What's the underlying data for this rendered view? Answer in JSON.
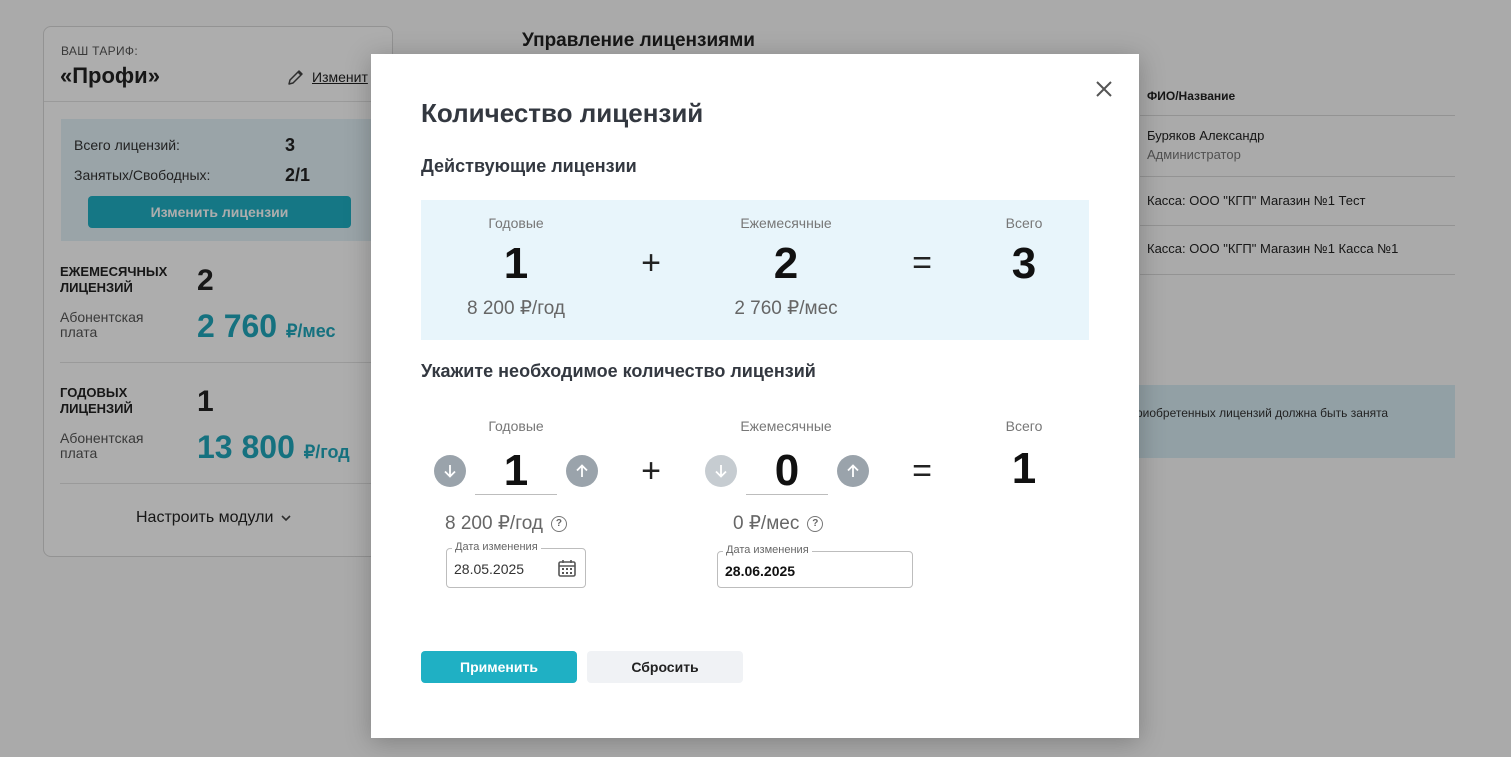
{
  "background": {
    "tariff": {
      "label": "ВАШ ТАРИФ:",
      "name": "«Профи»",
      "edit_label": "Изменит"
    },
    "licenses": {
      "total_label": "Всего лицензий:",
      "total_value": "3",
      "busy_label": "Занятых/Свободных:",
      "busy_value": "2/1",
      "change_button": "Изменить лицензии"
    },
    "monthly": {
      "title_line1": "ЕЖЕМЕСЯЧНЫХ",
      "title_line2": "лицензий",
      "count": "2",
      "fee_line1": "Абонентская",
      "fee_line2": "плата",
      "fee_value": "2 760",
      "fee_unit": "₽/мес"
    },
    "annual": {
      "title_line1": "ГОДОВЫХ",
      "title_line2": "лицензий",
      "count": "1",
      "fee_line1": "Абонентская",
      "fee_line2": "плата",
      "fee_value": "13 800",
      "fee_unit": "₽/год"
    },
    "modules_label": "Настроить модули",
    "management_title": "Управление лицензиями",
    "users_table": {
      "header": "ФИО/Название",
      "rows": [
        {
          "name": "Буряков Александр",
          "role": "Администратор"
        },
        {
          "name": "Касса: ООО \"КГП\" Магазин №1 Тест",
          "role": ""
        },
        {
          "name": "Касса: ООО \"КГП\" Магазин №1 Касса №1",
          "role": ""
        }
      ]
    },
    "info_text": "риобретенных лицензий должна быть занята"
  },
  "modal": {
    "title": "Количество лицензий",
    "current_title": "Действующие лицензии",
    "current": {
      "annual_caption": "Годовые",
      "annual_count": "1",
      "annual_price": "8 200 ₽/год",
      "plus": "+",
      "monthly_caption": "Ежемесячные",
      "monthly_count": "2",
      "monthly_price": "2 760 ₽/мес",
      "equals": "=",
      "total_caption": "Всего",
      "total_count": "3"
    },
    "needed_title": "Укажите необходимое количество лицензий",
    "needed": {
      "annual_caption": "Годовые",
      "annual_count": "1",
      "annual_price": "8 200 ₽/год",
      "monthly_caption": "Ежемесячные",
      "monthly_count": "0",
      "monthly_price": "0 ₽/мес",
      "plus": "+",
      "equals": "=",
      "total_caption": "Всего",
      "total_count": "1",
      "help_glyph": "?"
    },
    "annual_date": {
      "label": "Дата изменения",
      "value": "28.05.2025"
    },
    "monthly_date": {
      "label": "Дата изменения",
      "value": "28.06.2025"
    },
    "apply_button": "Применить",
    "reset_button": "Сбросить"
  },
  "colors": {
    "accent": "#1fb0c4",
    "fee_accent": "#1fa7bb",
    "info_box": "#e8f5fb"
  }
}
